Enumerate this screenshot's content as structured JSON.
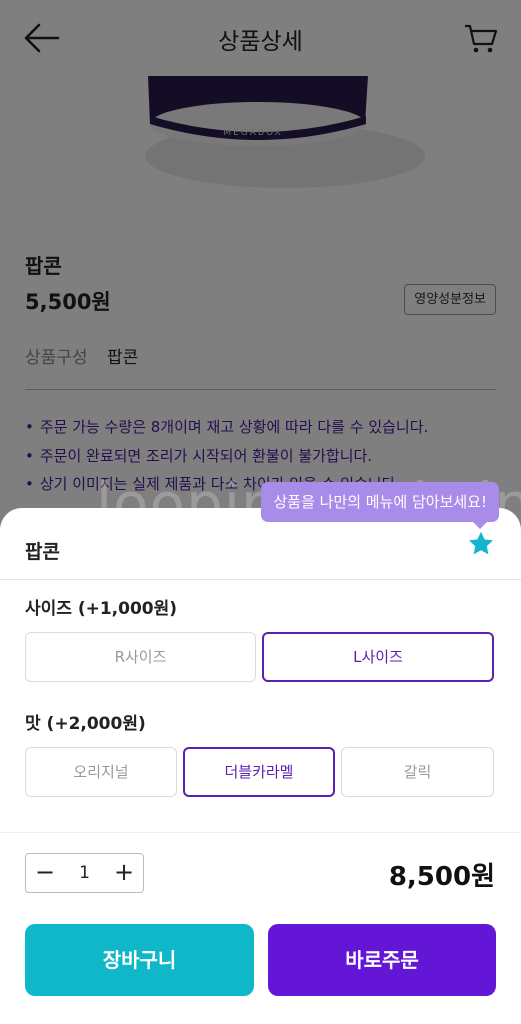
{
  "header": {
    "title": "상품상세",
    "back_icon": "arrow-left-icon",
    "cart_icon": "cart-icon"
  },
  "product": {
    "name": "팝콘",
    "price": "5,500원",
    "nutrition_button": "영양성분정보",
    "composition_label": "상품구성",
    "composition_value": "팝콘",
    "cup_brand": "MEGABOX",
    "notices": [
      "주문 가능 수량은 8개이며 재고 상황에 따라 다를 수 있습니다.",
      "주문이 완료되면 조리가 시작되어 환불이 불가합니다.",
      "상기 이미지는 실제 제품과 다소 차이가 있을 수 있습니다."
    ]
  },
  "watermark": "loopingandwin",
  "sheet": {
    "title": "팝콘",
    "tooltip": "상품을 나만의 메뉴에 담아보세요!",
    "star_icon": "star-icon",
    "size": {
      "label": "사이즈 (+1,000원)",
      "options": [
        "R사이즈",
        "L사이즈"
      ],
      "selected": "L사이즈"
    },
    "flavor": {
      "label": "맛 (+2,000원)",
      "options": [
        "오리지널",
        "더블카라멜",
        "갈릭"
      ],
      "selected": "더블카라멜"
    },
    "quantity": {
      "minus": "−",
      "value": "1",
      "plus": "+"
    },
    "total_price": "8,500원",
    "cart_button": "장바구니",
    "order_button": "바로주문"
  },
  "colors": {
    "accent_purple": "#6316d6",
    "accent_teal": "#10b7c9",
    "tooltip_purple": "#a98bea",
    "star_teal": "#14b4cc",
    "notice_text": "#4b1d9a"
  }
}
